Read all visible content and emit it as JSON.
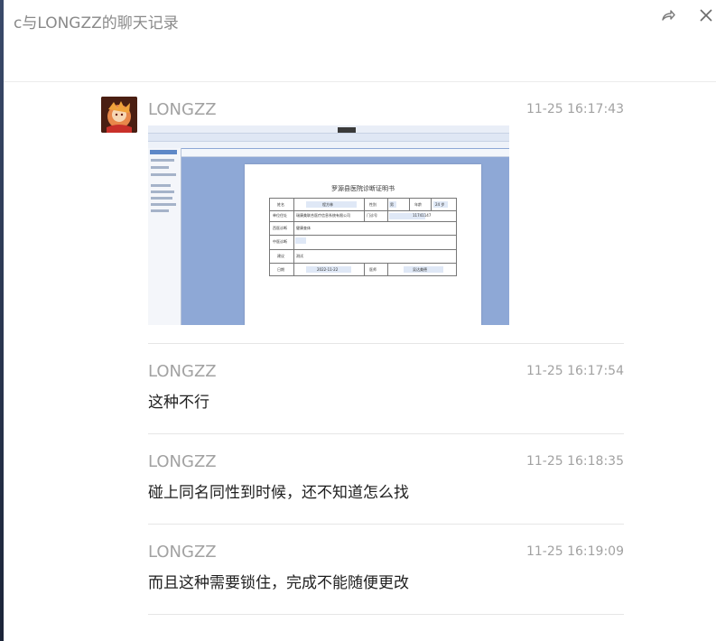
{
  "window": {
    "title": "c与LONGZZ的聊天记录"
  },
  "messages": [
    {
      "sender": "LONGZZ",
      "time": "11-25 16:17:43",
      "type": "image",
      "text": ""
    },
    {
      "sender": "LONGZZ",
      "time": "11-25 16:17:54",
      "type": "text",
      "text": "这种不行"
    },
    {
      "sender": "LONGZZ",
      "time": "11-25 16:18:35",
      "type": "text",
      "text": "碰上同名同性到时候，还不知道怎么找"
    },
    {
      "sender": "LONGZZ",
      "time": "11-25 16:19:09",
      "type": "text",
      "text": "而且这种需要锁住，完成不能随便更改"
    }
  ],
  "screenshot": {
    "doc_title": "罗源县医院诊断证明书",
    "fields": [
      "姓名",
      "性别",
      "年龄",
      "单位住址",
      "门诊号",
      "西医诊断",
      "中医诊断",
      "建议",
      "日期",
      "医师"
    ],
    "values": [
      "程方林",
      "男",
      "24 岁",
      "瑞康美联合医疗信息系统有限公司",
      "11741147",
      "健康查体",
      "",
      "测试",
      "2022-11-22",
      "吴达美德"
    ]
  },
  "icons": {
    "share": "share-arrow-icon",
    "close": "close-icon"
  },
  "colors": {
    "window_bg": "#ffffff",
    "meta_text": "#a2a2a2",
    "message_text": "#1f1f1f"
  }
}
